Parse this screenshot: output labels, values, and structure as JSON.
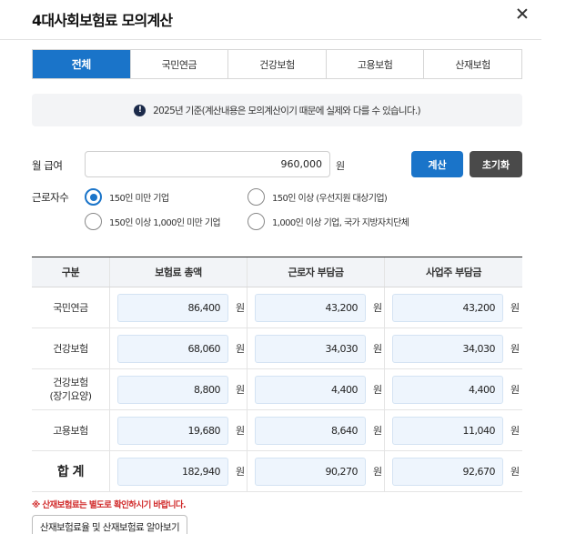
{
  "dialog": {
    "title": "4대사회보험료 모의계산"
  },
  "tabs": [
    {
      "label": "전체",
      "active": true
    },
    {
      "label": "국민연금",
      "active": false
    },
    {
      "label": "건강보험",
      "active": false
    },
    {
      "label": "고용보험",
      "active": false
    },
    {
      "label": "산재보험",
      "active": false
    }
  ],
  "notice": {
    "icon": "exclamation-icon",
    "text": "2025년 기준(계산내용은 모의계산이기 때문에 실제와 다를 수 있습니다.)"
  },
  "form": {
    "salary_label": "월 급여",
    "salary_value": "960,000",
    "salary_unit": "원",
    "calc_button": "계산",
    "reset_button": "초기화",
    "workers_label": "근로자수",
    "worker_options": [
      {
        "label": "150인 미만 기업",
        "selected": true
      },
      {
        "label": "150인 이상 (우선지원 대상기업)",
        "selected": false
      },
      {
        "label": "150인 이상 1,000인 미만 기업",
        "selected": false
      },
      {
        "label": "1,000인 이상 기업, 국가 지방자치단체",
        "selected": false
      }
    ]
  },
  "table": {
    "headers": [
      "구분",
      "보험료 총액",
      "근로자 부담금",
      "사업주 부담금"
    ],
    "unit": "원",
    "rows": [
      {
        "label": "국민연금",
        "total": "86,400",
        "worker": "43,200",
        "employer": "43,200"
      },
      {
        "label": "건강보험",
        "total": "68,060",
        "worker": "34,030",
        "employer": "34,030"
      },
      {
        "label": "건강보험\n(장기요양)",
        "total": "8,800",
        "worker": "4,400",
        "employer": "4,400"
      },
      {
        "label": "고용보험",
        "total": "19,680",
        "worker": "8,640",
        "employer": "11,040"
      }
    ],
    "total_row": {
      "label": "합 계",
      "total": "182,940",
      "worker": "90,270",
      "employer": "92,670"
    }
  },
  "footer": {
    "warning": "※ 산재보험료는 별도로 확인하시기 바랍니다.",
    "link_button": "산재보험료율 및 산재보험료 알아보기"
  },
  "colors": {
    "primary": "#1a74c9",
    "reset_button": "#4a4a4a",
    "warning": "#d12b2b",
    "amount_bg": "#eef5fd"
  }
}
